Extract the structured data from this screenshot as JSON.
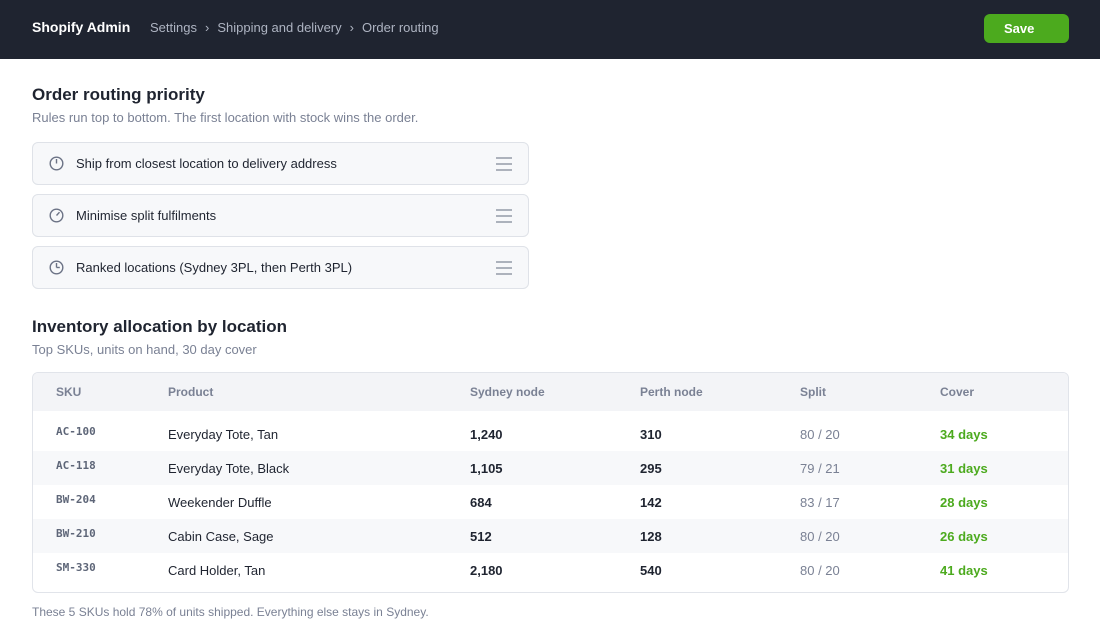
{
  "app": {
    "brand": "Shopify Admin"
  },
  "breadcrumb": {
    "items": [
      "Settings",
      "Shipping and delivery",
      "Order routing"
    ],
    "separator": "›"
  },
  "toolbar": {
    "save_label": "Save"
  },
  "routing": {
    "title": "Order routing priority",
    "subtitle": "Rules run top to bottom. The first location with stock wins the order.",
    "rules": [
      {
        "label": "Ship from closest location to delivery address",
        "icon": "clock-icon"
      },
      {
        "label": "Minimise split fulfilments",
        "icon": "clock-icon"
      },
      {
        "label": "Ranked locations (Sydney 3PL, then Perth 3PL)",
        "icon": "clock-icon"
      }
    ]
  },
  "inventory": {
    "title": "Inventory allocation by location",
    "subtitle": "Top SKUs, units on hand, 30 day cover",
    "columns": [
      "SKU",
      "Product",
      "Sydney node",
      "Perth node",
      "Split",
      "Cover"
    ],
    "rows": [
      {
        "sku": "AC-100",
        "product": "Everyday Tote, Tan",
        "sydney": "1,240",
        "perth": "310",
        "split": "80 / 20",
        "cover": "34 days"
      },
      {
        "sku": "AC-118",
        "product": "Everyday Tote, Black",
        "sydney": "1,105",
        "perth": "295",
        "split": "79 / 21",
        "cover": "31 days"
      },
      {
        "sku": "BW-204",
        "product": "Weekender Duffle",
        "sydney": "684",
        "perth": "142",
        "split": "83 / 17",
        "cover": "28 days"
      },
      {
        "sku": "BW-210",
        "product": "Cabin Case, Sage",
        "sydney": "512",
        "perth": "128",
        "split": "80 / 20",
        "cover": "26 days"
      },
      {
        "sku": "SM-330",
        "product": "Card Holder, Tan",
        "sydney": "2,180",
        "perth": "540",
        "split": "80 / 20",
        "cover": "41 days"
      }
    ],
    "footnote": "These 5 SKUs hold 78% of units shipped. Everything else stays in Sydney."
  },
  "colors": {
    "topbar": "#1f2430",
    "accent": "#4caa1e",
    "muted": "#7a8194"
  }
}
